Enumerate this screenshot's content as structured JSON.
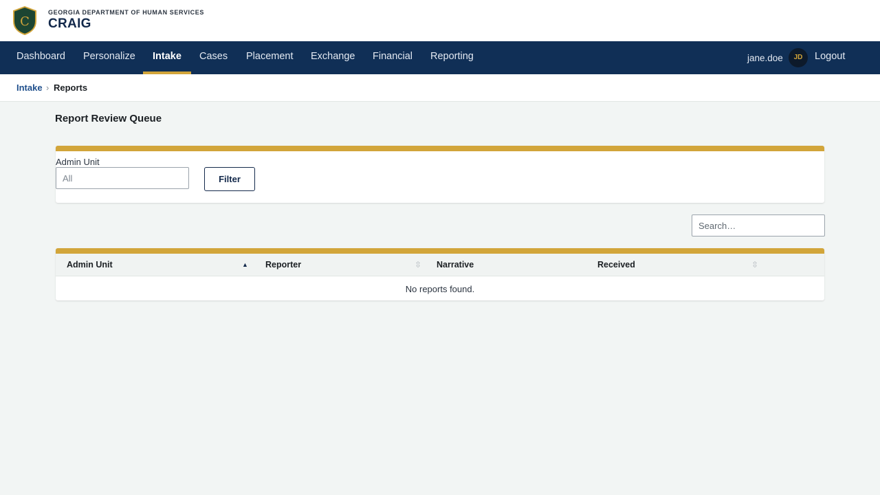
{
  "header": {
    "org_name": "GEORGIA DEPARTMENT OF HUMAN SERVICES",
    "app_name": "CRAIG",
    "logo_letter": "C",
    "colors": {
      "brand_navy": "#102f56",
      "accent_gold": "#d2a53a",
      "logo_green": "#1c4532"
    }
  },
  "nav": {
    "items": [
      {
        "label": "Dashboard"
      },
      {
        "label": "Personalize"
      },
      {
        "label": "Intake",
        "active": true
      },
      {
        "label": "Cases"
      },
      {
        "label": "Placement"
      },
      {
        "label": "Exchange"
      },
      {
        "label": "Financial"
      },
      {
        "label": "Reporting"
      }
    ],
    "username": "jane.doe",
    "avatar_initials": "JD",
    "logout_label": "Logout"
  },
  "breadcrumb": {
    "parent": "Intake",
    "separator": "›",
    "current": "Reports"
  },
  "page": {
    "title": "Report Review Queue"
  },
  "filter": {
    "admin_unit_label": "Admin Unit",
    "admin_unit_placeholder": "All",
    "admin_unit_value": "",
    "filter_button_label": "Filter"
  },
  "search": {
    "placeholder": "Search…"
  },
  "table": {
    "columns": [
      {
        "label": "Admin Unit",
        "sort": "ascending",
        "sort_icon": "sort-ascending-icon",
        "sort_glyph": "▲"
      },
      {
        "label": "Reporter",
        "sort": "none",
        "sort_icon": "sort-icon",
        "sort_glyph": "⇳"
      },
      {
        "label": "Narrative",
        "sort": "none"
      },
      {
        "label": "Received",
        "sort": "none",
        "sort_icon": "sort-icon",
        "sort_glyph": "⇳"
      }
    ],
    "rows": [],
    "empty_message": "No reports found."
  }
}
